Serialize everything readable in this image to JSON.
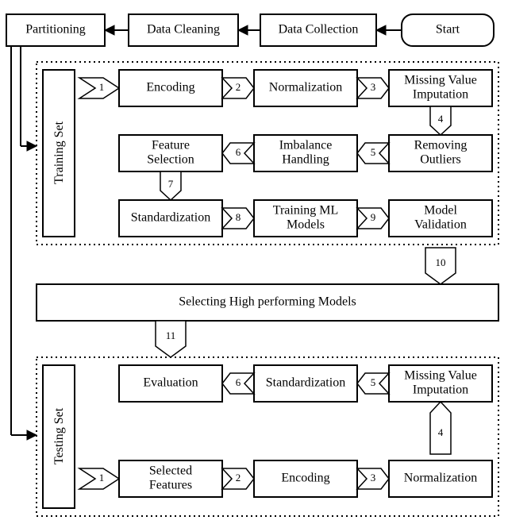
{
  "top": {
    "start": "Start",
    "collect": "Data Collection",
    "clean": "Data Cleaning",
    "partition": "Partitioning"
  },
  "training": {
    "label": "Training Set",
    "encoding": "Encoding",
    "normalization": "Normalization",
    "mvi_l1": "Missing Value",
    "mvi_l2": "Imputation",
    "feature_l1": "Feature",
    "feature_l2": "Selection",
    "imbalance_l1": "Imbalance",
    "imbalance_l2": "Handling",
    "outliers_l1": "Removing",
    "outliers_l2": "Outliers",
    "standardization": "Standardization",
    "trainml_l1": "Training ML",
    "trainml_l2": "Models",
    "validation_l1": "Model",
    "validation_l2": "Validation",
    "n1": "1",
    "n2": "2",
    "n3": "3",
    "n4": "4",
    "n5": "5",
    "n6": "6",
    "n7": "7",
    "n8": "8",
    "n9": "9"
  },
  "middle": {
    "select": "Selecting High performing Models",
    "n10": "10",
    "n11": "11"
  },
  "testing": {
    "label": "Testing Set",
    "evaluation": "Evaluation",
    "standardization": "Standardization",
    "mvi_l1": "Missing Value",
    "mvi_l2": "Imputation",
    "selected_l1": "Selected",
    "selected_l2": "Features",
    "encoding": "Encoding",
    "normalization": "Normalization",
    "n1": "1",
    "n2": "2",
    "n3": "3",
    "n4": "4",
    "n5": "5",
    "n6": "6"
  }
}
